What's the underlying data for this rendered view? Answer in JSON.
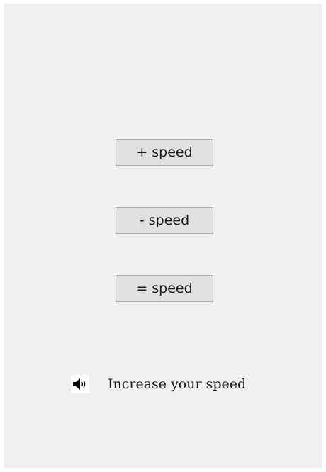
{
  "buttons": {
    "increase": "+ speed",
    "decrease": "- speed",
    "equal": "= speed"
  },
  "status": {
    "icon": "speaker-icon",
    "text": "Increase your speed"
  }
}
